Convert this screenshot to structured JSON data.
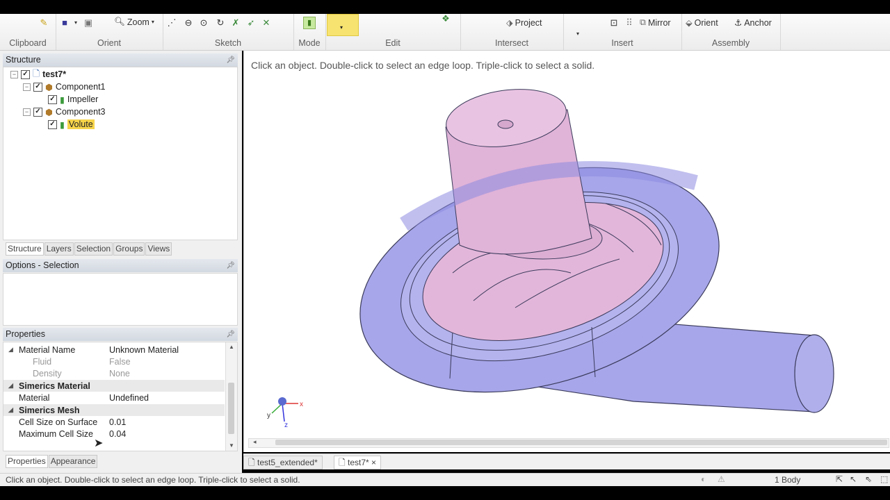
{
  "ribbon": {
    "groups": {
      "clipboard": "Clipboard",
      "orient": "Orient",
      "sketch": "Sketch",
      "mode": "Mode",
      "edit": "Edit",
      "intersect": "Intersect",
      "insert": "Insert",
      "assembly": "Assembly"
    },
    "zoom_label": "Zoom",
    "project_label": "Project",
    "mirror_label": "Mirror",
    "orient_label": "Orient",
    "anchor_label": "Anchor"
  },
  "structure": {
    "title": "Structure",
    "tree": [
      {
        "label": "test7*"
      },
      {
        "label": "Component1"
      },
      {
        "label": "Impeller"
      },
      {
        "label": "Component3"
      },
      {
        "label": "Volute"
      }
    ],
    "tabs": [
      "Structure",
      "Layers",
      "Selection",
      "Groups",
      "Views"
    ]
  },
  "options": {
    "title": "Options - Selection"
  },
  "properties": {
    "title": "Properties",
    "rows": [
      {
        "key": "Material Name",
        "value": "Unknown Material"
      },
      {
        "key": "Fluid",
        "value": "False"
      },
      {
        "key": "Density",
        "value": "None"
      },
      {
        "key": "Simerics Material",
        "value": ""
      },
      {
        "key": "Material",
        "value": "Undefined"
      },
      {
        "key": "Simerics Mesh",
        "value": ""
      },
      {
        "key": "Cell Size on Surface",
        "value": "0.01"
      },
      {
        "key": "Maximum Cell Size",
        "value": "0.04"
      }
    ],
    "tabs": [
      "Properties",
      "Appearance"
    ]
  },
  "viewport": {
    "hint": "Click an object. Double-click to select an edge loop. Triple-click to select a solid.",
    "axis": {
      "x": "x",
      "y": "y",
      "z": "z"
    }
  },
  "doc_tabs": [
    "test5_extended*",
    "test7*"
  ],
  "doc_tab_close": "×",
  "status": {
    "message": "Click an object. Double-click to select an edge loop. Triple-click to select a solid.",
    "body_count": "1 Body"
  },
  "colors": {
    "volute": "#a7a6ea",
    "impeller": "#e2b6da",
    "selection_highlight": "#f6d44a"
  }
}
